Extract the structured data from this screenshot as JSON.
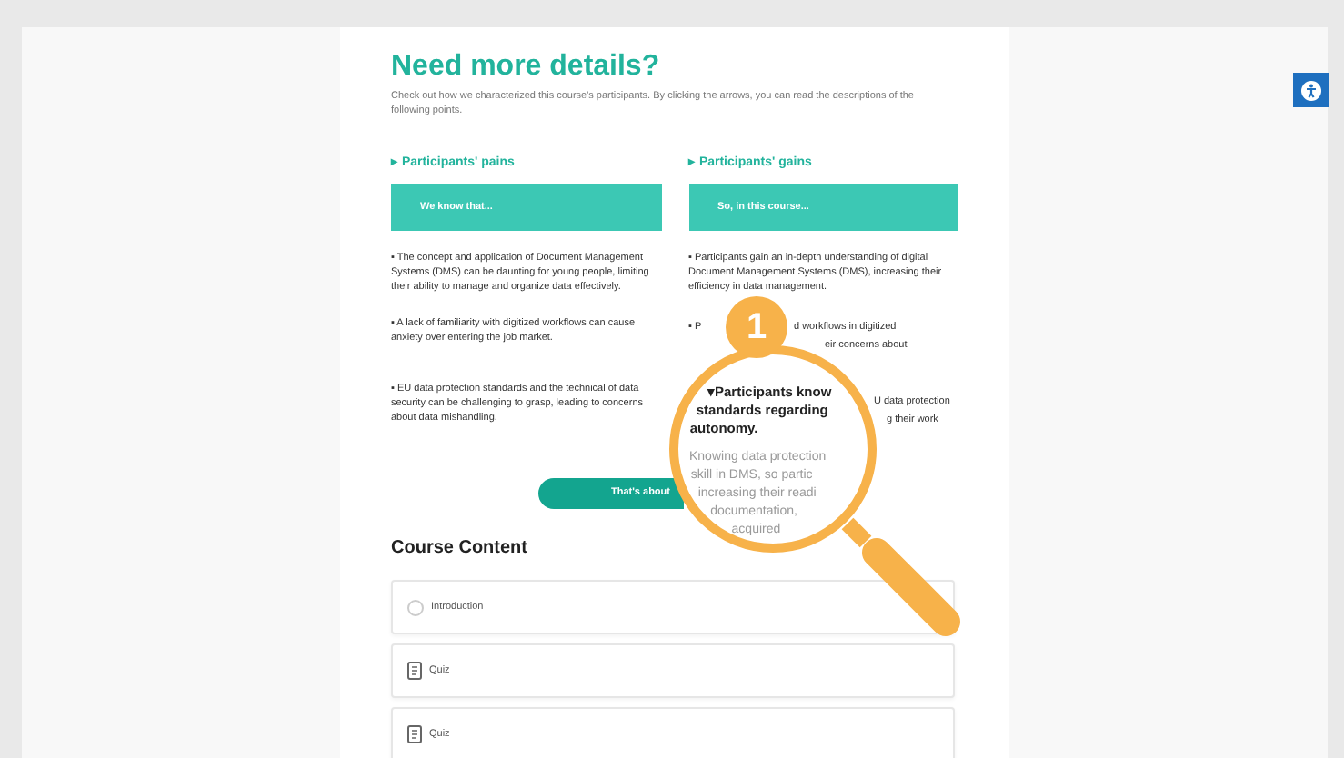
{
  "heading": "Need more details?",
  "description": "Check out how we characterized this course's participants. By clicking the arrows, you can read the descriptions of the following points.",
  "columns": [
    {
      "label": "▸ Participants' pains",
      "box": "We know that...",
      "items": [
        {
          "lines": [
            "▪ The concept and application of Document Management Systems (DMS) can be daunting for young people, limiting their ability to manage and organize data effectively."
          ]
        },
        {
          "lines": [
            "▪ A lack of familiarity with digitized workflows can cause anxiety over entering the job market."
          ]
        },
        {
          "lines": [
            "▪ EU data protection standards and the technical of data security can be challenging to grasp, leading to concerns about data mishandling."
          ]
        }
      ]
    },
    {
      "label": "▸ Participants' gains",
      "box": "So, in this course...",
      "items": [
        {
          "lines": [
            "▪ Participants gain an in-depth understanding of digital Document Management Systems (DMS), increasing their efficiency in data management."
          ]
        },
        {
          "fragments": [
            "▪ P",
            "d workflows in digitized",
            "eir concerns about"
          ]
        },
        {
          "fragments": [
            "U data protection",
            "g their work"
          ]
        }
      ]
    }
  ],
  "button": "That's about",
  "magnifier": {
    "badge": "1",
    "title": [
      "▾Participants know",
      "standards regarding",
      "autonomy."
    ],
    "body": [
      "Knowing data protection",
      "skill in DMS, so partic",
      "increasing their readi",
      "documentation,",
      "acquired"
    ]
  },
  "course_content": {
    "title": "Course Content",
    "items": [
      {
        "kind": "lesson",
        "label": "Introduction"
      },
      {
        "kind": "quiz",
        "label": "Quiz"
      },
      {
        "kind": "quiz",
        "label": "Quiz"
      }
    ]
  }
}
